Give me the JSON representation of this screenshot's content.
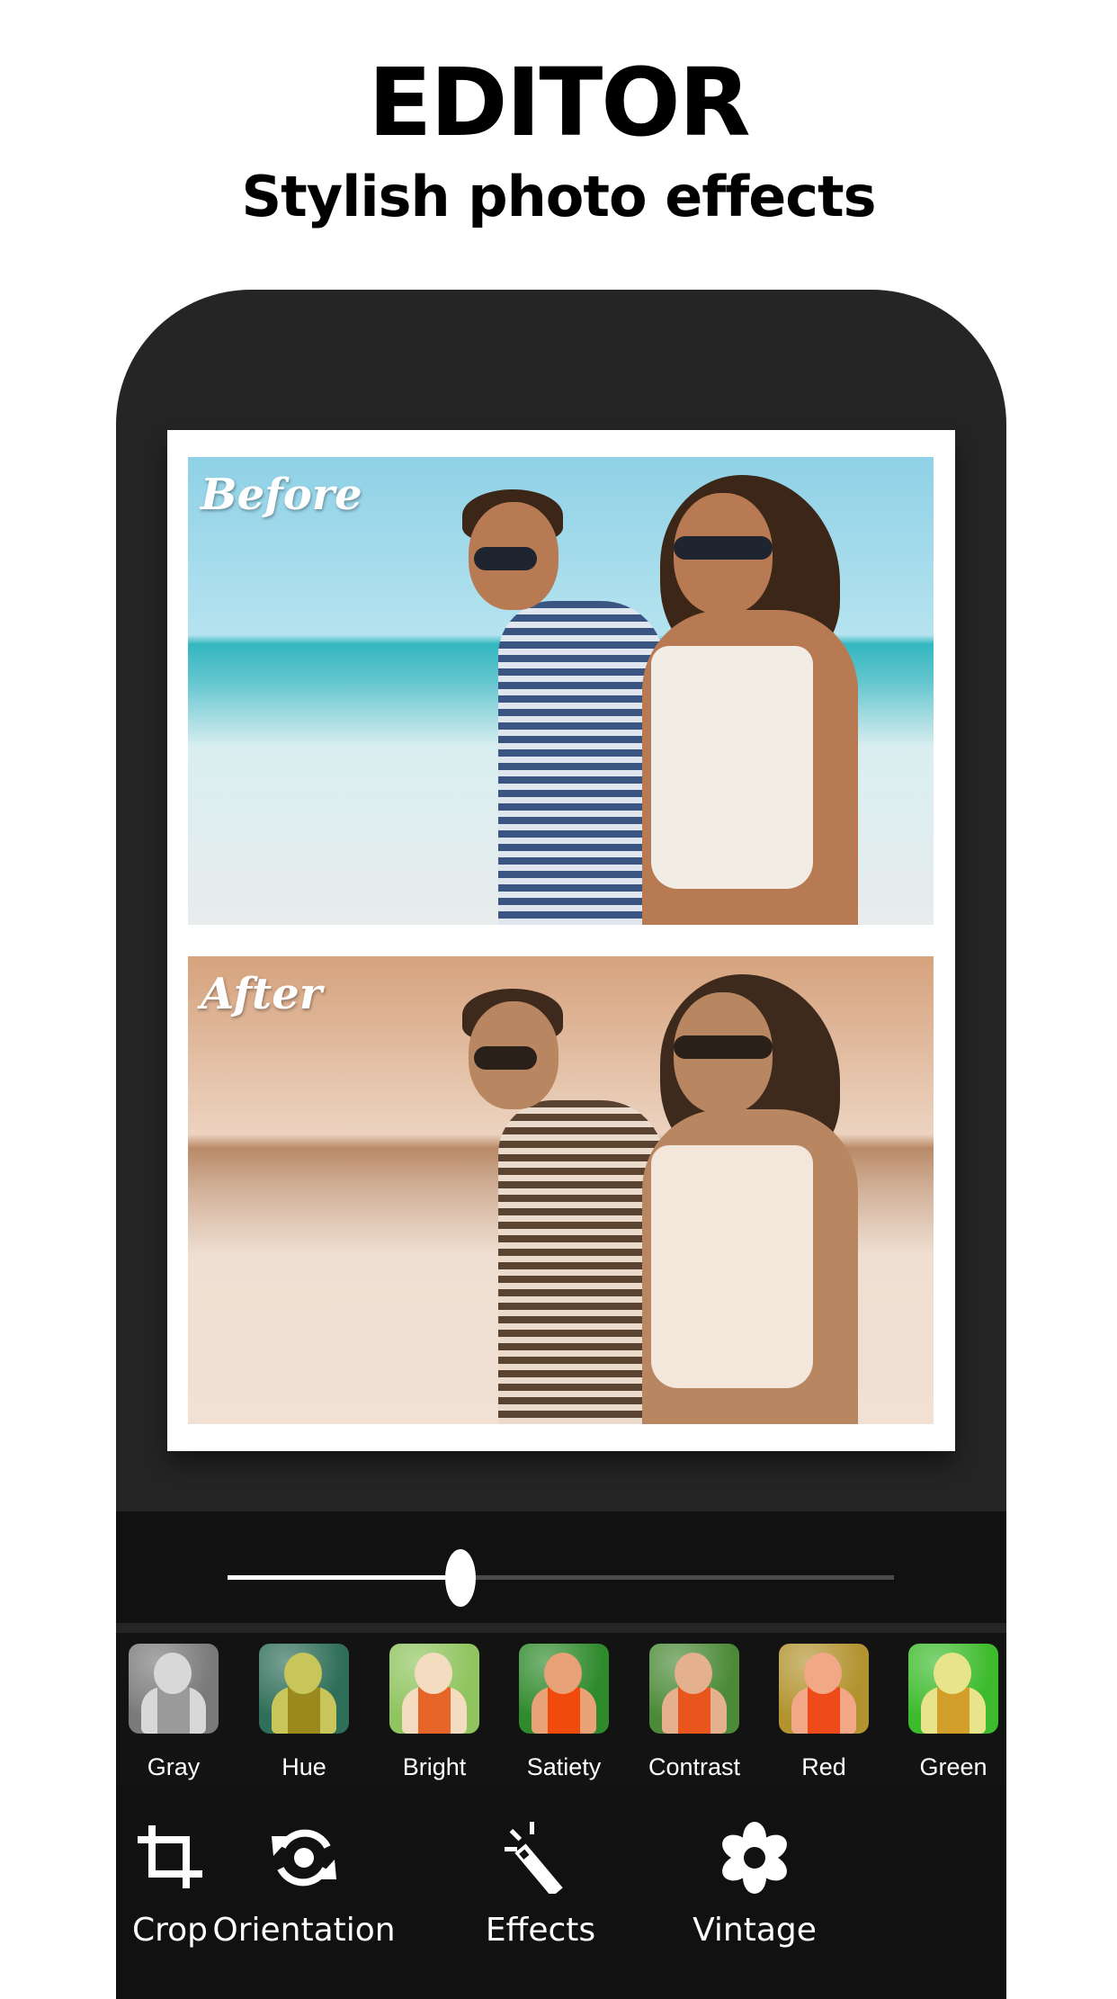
{
  "header": {
    "title": "EDITOR",
    "subtitle": "Stylish photo effects"
  },
  "preview": {
    "before_label": "Before",
    "after_label": "After"
  },
  "slider": {
    "value_fraction": 0.35
  },
  "filters": [
    {
      "label": "Gray",
      "icon": "gray-filter-thumbnail",
      "bg": "#7a7a7a",
      "skin": "#d8d8d8",
      "shirt": "#9a9a9a"
    },
    {
      "label": "Hue",
      "icon": "hue-filter-thumbnail",
      "bg": "#2f6e58",
      "skin": "#c8c65a",
      "shirt": "#9a8a1e"
    },
    {
      "label": "Bright",
      "icon": "bright-filter-thumbnail",
      "bg": "#8fc45e",
      "skin": "#f4dcc0",
      "shirt": "#e8652a"
    },
    {
      "label": "Satiety",
      "icon": "satiety-filter-thumbnail",
      "bg": "#2f8a2c",
      "skin": "#e9a277",
      "shirt": "#f04a0c"
    },
    {
      "label": "Contrast",
      "icon": "contrast-filter-thumbnail",
      "bg": "#4c8a38",
      "skin": "#e4b08e",
      "shirt": "#e9561d"
    },
    {
      "label": "Red",
      "icon": "red-filter-thumbnail",
      "bg": "#b2932f",
      "skin": "#f2a787",
      "shirt": "#ef4a1a"
    },
    {
      "label": "Green",
      "icon": "green-filter-thumbnail",
      "bg": "#3dbb2c",
      "skin": "#e8e48c",
      "shirt": "#d2a02a"
    }
  ],
  "toolbar": [
    {
      "label": "Crop",
      "icon": "crop-icon"
    },
    {
      "label": "Orientation",
      "icon": "rotate-icon"
    },
    {
      "label": "Effects",
      "icon": "magic-wand-icon"
    },
    {
      "label": "Vintage",
      "icon": "flower-icon"
    }
  ]
}
